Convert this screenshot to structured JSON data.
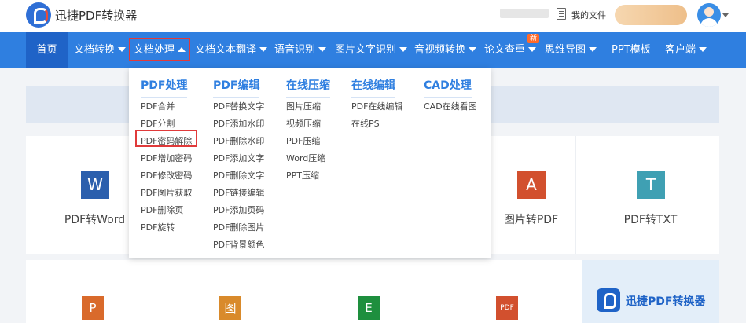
{
  "header": {
    "brand": "迅捷PDF转换器",
    "my_files": "我的文件"
  },
  "nav": {
    "items": [
      "首页",
      "文档转换",
      "文档处理",
      "文档文本翻译",
      "语音识别",
      "图片文字识别",
      "音视频转换",
      "论文查重",
      "思维导图",
      "PPT模板",
      "客户端"
    ],
    "new_badge": "新"
  },
  "dropdown": {
    "columns": [
      {
        "title": "PDF处理",
        "items": [
          "PDF合并",
          "PDF分割",
          "PDF密码解除",
          "PDF增加密码",
          "PDF修改密码",
          "PDF图片获取",
          "PDF删除页",
          "PDF旋转"
        ]
      },
      {
        "title": "PDF编辑",
        "items": [
          "PDF替换文字",
          "PDF添加水印",
          "PDF删除水印",
          "PDF添加文字",
          "PDF删除文字",
          "PDF链接编辑",
          "PDF添加页码",
          "PDF删除图片",
          "PDF背景颜色"
        ]
      },
      {
        "title": "在线压缩",
        "items": [
          "图片压缩",
          "视频压缩",
          "PDF压缩",
          "Word压缩",
          "PPT压缩"
        ]
      },
      {
        "title": "在线编辑",
        "items": [
          "PDF在线编辑",
          "在线PS"
        ]
      },
      {
        "title": "CAD处理",
        "items": [
          "CAD在线看图"
        ]
      }
    ]
  },
  "cards": {
    "row1": [
      {
        "label": "PDF转Word",
        "icon": "W",
        "color": "#2b5fad"
      },
      {
        "label": "图片转PDF",
        "icon": "A",
        "color": "#d2502e"
      },
      {
        "label": "PDF转TXT",
        "icon": "T",
        "color": "#3fa0b3"
      }
    ],
    "row2_icons": [
      {
        "icon": "P",
        "color": "#d96a2b"
      },
      {
        "icon": "图",
        "color": "#d98a2b"
      },
      {
        "icon": "E",
        "color": "#1e8f3e"
      },
      {
        "icon": "PDF",
        "color": "#d2502e"
      }
    ]
  },
  "promo": {
    "text": "迅捷PDF转换器"
  },
  "colors": {
    "nav": "#2f7fe0",
    "nav_active": "#1f63c7",
    "highlight": "#e03a3a",
    "title_blue": "#2f7fe0"
  }
}
